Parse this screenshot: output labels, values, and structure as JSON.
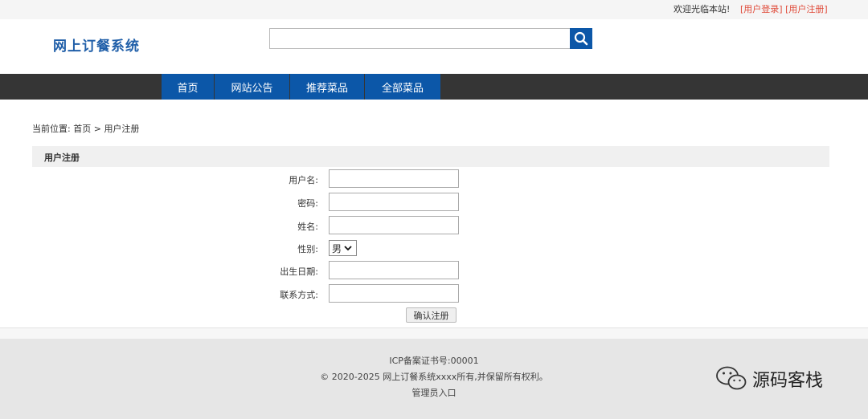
{
  "topbar": {
    "welcome": "欢迎光临本站!",
    "login_link": "[用户登录]",
    "register_link": "[用户注册]"
  },
  "header": {
    "logo": "网上订餐系统",
    "search": {
      "value": "",
      "placeholder": ""
    },
    "search_icon": "search-icon"
  },
  "nav": {
    "items": [
      {
        "label": "首页"
      },
      {
        "label": "网站公告"
      },
      {
        "label": "推荐菜品"
      },
      {
        "label": "全部菜品"
      }
    ]
  },
  "breadcrumb": {
    "prefix": "当前位置:",
    "home": "首页",
    "separator": ">",
    "current": "用户注册"
  },
  "section": {
    "title": "用户注册"
  },
  "form": {
    "username_label": "用户名:",
    "password_label": "密码:",
    "realname_label": "姓名:",
    "gender_label": "性别:",
    "gender_value": "男",
    "birthday_label": "出生日期:",
    "contact_label": "联系方式:",
    "submit_label": "确认注册"
  },
  "footer": {
    "icp": "ICP备案证书号:00001",
    "copyright": "© 2020-2025 网上订餐系统xxxx所有,并保留所有权利。",
    "admin_link": "管理员入口"
  },
  "watermark": {
    "text": "源码客栈"
  },
  "colors": {
    "brand": "#0c57a8",
    "nav_bg": "#353535",
    "link_red": "#e04b3a",
    "logo": "#1f5ea8"
  }
}
